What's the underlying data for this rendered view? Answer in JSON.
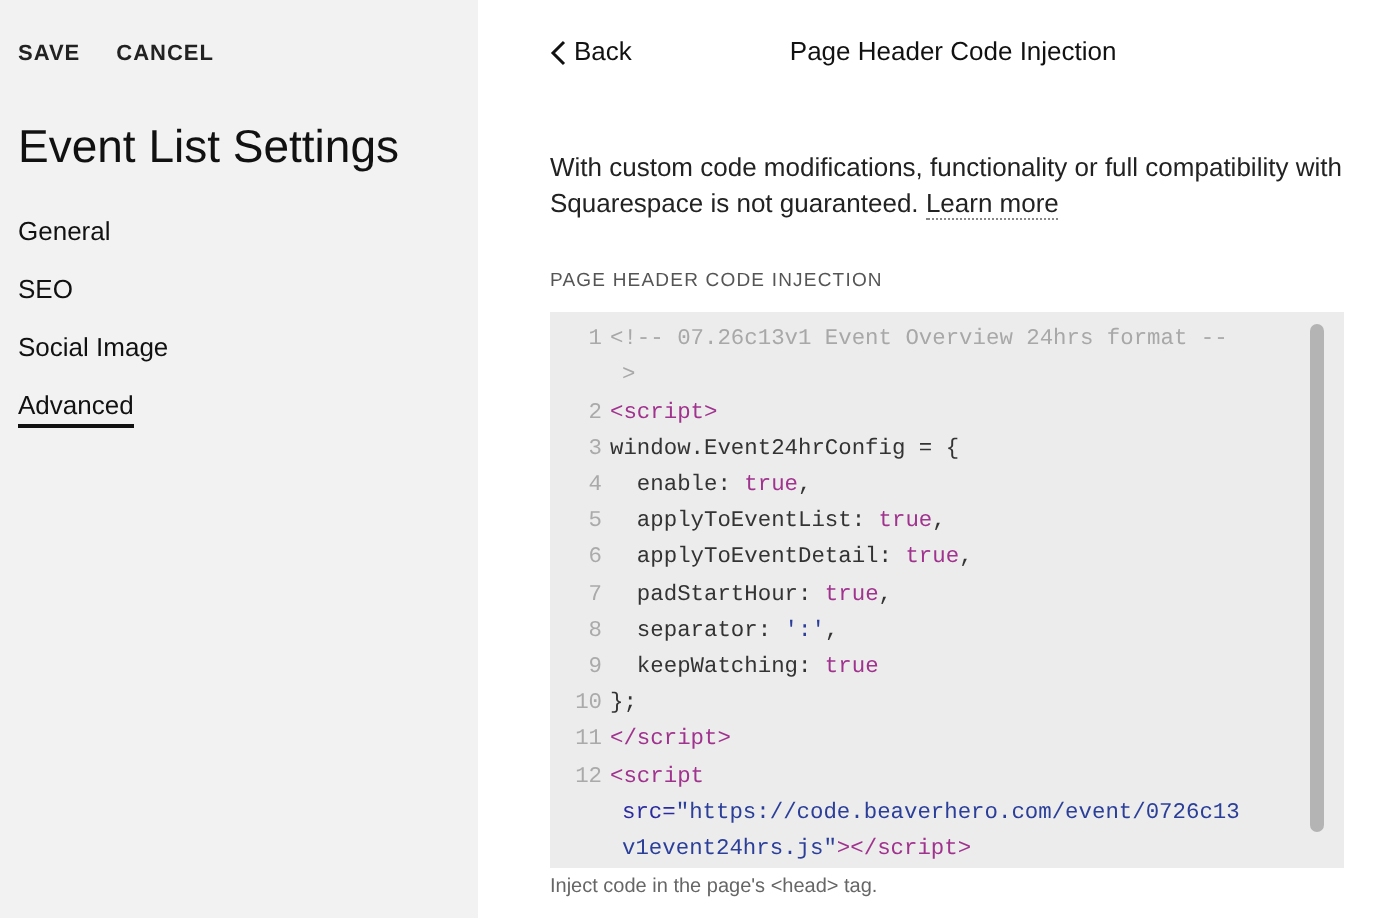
{
  "sidebar": {
    "actions": [
      "SAVE",
      "CANCEL"
    ],
    "title": "Event List Settings",
    "items": [
      {
        "label": "General",
        "selected": false
      },
      {
        "label": "SEO",
        "selected": false
      },
      {
        "label": "Social Image",
        "selected": false
      },
      {
        "label": "Advanced",
        "selected": true
      }
    ]
  },
  "header": {
    "back": "Back",
    "title": "Page Header Code Injection"
  },
  "notice": {
    "text": "With custom code modifications, functionality or full compatibility with Squarespace is not guaranteed.",
    "link": "Learn more"
  },
  "editor": {
    "label": "PAGE HEADER CODE INJECTION",
    "lines": [
      {
        "number": "1",
        "rows": [
          [
            {
              "kind": "comment",
              "text": "<!-- 07.26c13v1 Event Overview 24hrs format --"
            }
          ],
          [
            {
              "kind": "comment",
              "text": ">"
            }
          ]
        ]
      },
      {
        "number": "2",
        "rows": [
          [
            {
              "kind": "tag",
              "text": "<script>"
            }
          ]
        ]
      },
      {
        "number": "3",
        "rows": [
          [
            {
              "kind": "plain",
              "text": "window.Event24hrConfig = {"
            }
          ]
        ]
      },
      {
        "number": "4",
        "rows": [
          [
            {
              "kind": "plain",
              "text": "  enable: "
            },
            {
              "kind": "keyword",
              "text": "true"
            },
            {
              "kind": "plain",
              "text": ","
            }
          ]
        ]
      },
      {
        "number": "5",
        "rows": [
          [
            {
              "kind": "plain",
              "text": "  applyToEventList: "
            },
            {
              "kind": "keyword",
              "text": "true"
            },
            {
              "kind": "plain",
              "text": ","
            }
          ]
        ]
      },
      {
        "number": "6",
        "rows": [
          [
            {
              "kind": "plain",
              "text": "  applyToEventDetail: "
            },
            {
              "kind": "keyword",
              "text": "true"
            },
            {
              "kind": "plain",
              "text": ","
            }
          ]
        ]
      },
      {
        "number": "7",
        "rows": [
          [
            {
              "kind": "plain",
              "text": "  padStartHour: "
            },
            {
              "kind": "keyword",
              "text": "true"
            },
            {
              "kind": "plain",
              "text": ","
            }
          ]
        ]
      },
      {
        "number": "8",
        "rows": [
          [
            {
              "kind": "plain",
              "text": "  separator: "
            },
            {
              "kind": "string",
              "text": "':'"
            },
            {
              "kind": "plain",
              "text": ","
            }
          ]
        ]
      },
      {
        "number": "9",
        "rows": [
          [
            {
              "kind": "plain",
              "text": "  keepWatching: "
            },
            {
              "kind": "keyword",
              "text": "true"
            }
          ]
        ]
      },
      {
        "number": "10",
        "rows": [
          [
            {
              "kind": "plain",
              "text": "};"
            }
          ]
        ]
      },
      {
        "number": "11",
        "rows": [
          [
            {
              "kind": "tag",
              "text": "</script>"
            }
          ]
        ]
      },
      {
        "number": "12",
        "rows": [
          [
            {
              "kind": "tag",
              "text": "<script"
            }
          ],
          [
            {
              "kind": "attr",
              "text": "src="
            },
            {
              "kind": "url",
              "text": "\"https://code.beaverhero.com/event/0726c13"
            }
          ],
          [
            {
              "kind": "url",
              "text": "v1event24hrs.js\""
            },
            {
              "kind": "tag",
              "text": "></script>"
            }
          ]
        ]
      }
    ],
    "hint": "Inject code in the page's <head> tag."
  }
}
